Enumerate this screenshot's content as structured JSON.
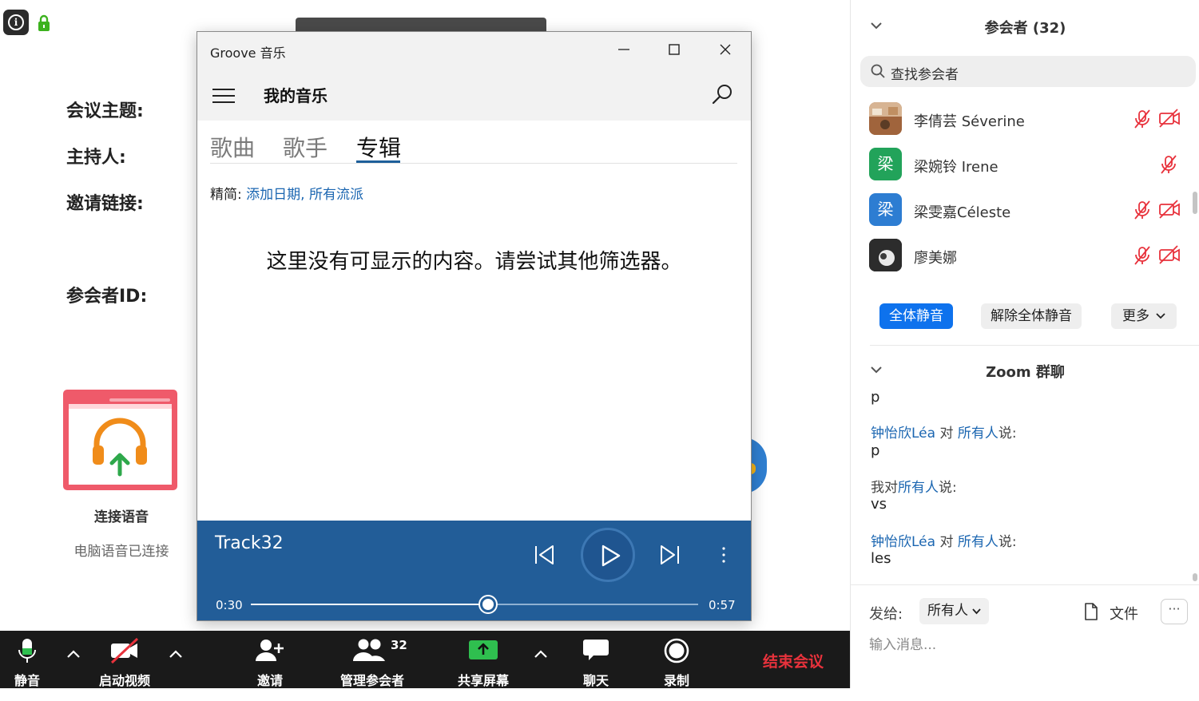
{
  "meeting": {
    "info_icon": "info-icon",
    "lock_icon": "lock-icon",
    "labels": {
      "topic": "会议主题:",
      "host": "主持人:",
      "invite_link": "邀请链接:",
      "participant_id": "参会者ID:"
    },
    "audio": {
      "connect_label": "连接语音",
      "status": "电脑语音已连接"
    }
  },
  "groove": {
    "title": "Groove 音乐",
    "heading": "我的音乐",
    "tabs": [
      {
        "label": "歌曲",
        "active": false
      },
      {
        "label": "歌手",
        "active": false
      },
      {
        "label": "专辑",
        "active": true
      }
    ],
    "filter_label": "精简:",
    "filter_value": "添加日期, 所有流派",
    "empty_message": "这里没有可显示的内容。请尝试其他筛选器。",
    "player": {
      "track": "Track32",
      "current_time": "0:30",
      "total_time": "0:57",
      "progress": 0.53
    }
  },
  "toolbar": {
    "mute": "静音",
    "start_video": "启动视频",
    "invite": "邀请",
    "manage_participants": "管理参会者",
    "participant_count": "32",
    "share_screen": "共享屏幕",
    "chat": "聊天",
    "record": "录制",
    "end_meeting": "结束会议"
  },
  "panel": {
    "participants_title": "参会者 (32)",
    "search_placeholder": "查找参会者",
    "participants": [
      {
        "name": "李倩芸 Séverine",
        "avatar": "photo",
        "mic_muted": true,
        "video_off": true
      },
      {
        "name": "梁婉铃 Irene",
        "avatar": "梁",
        "avatar_color": "#22a35a",
        "mic_muted": true,
        "video_off": false
      },
      {
        "name": "梁雯嘉Céleste",
        "avatar": "梁",
        "avatar_color": "#2d7dd2",
        "mic_muted": true,
        "video_off": true
      },
      {
        "name": "廖美娜",
        "avatar": "photo",
        "mic_muted": true,
        "video_off": true
      }
    ],
    "buttons": {
      "mute_all": "全体静音",
      "unmute_all": "解除全体静音",
      "more": "更多"
    },
    "chat_title": "Zoom 群聊",
    "chat": [
      {
        "message": "p"
      },
      {
        "sender": "钟怡欣Léa",
        "to_word": "对",
        "to": "所有人",
        "says": "说:",
        "message": "p"
      },
      {
        "sender": "我",
        "to_word": "对",
        "to": "所有人",
        "says": "说:",
        "message": "vs"
      },
      {
        "sender": "钟怡欣Léa",
        "to_word": "对",
        "to": "所有人",
        "says": "说:",
        "message": "les"
      }
    ],
    "send_to_label": "发给:",
    "send_to_value": "所有人",
    "file_label": "文件",
    "more_dots": "···",
    "input_placeholder": "输入消息..."
  }
}
